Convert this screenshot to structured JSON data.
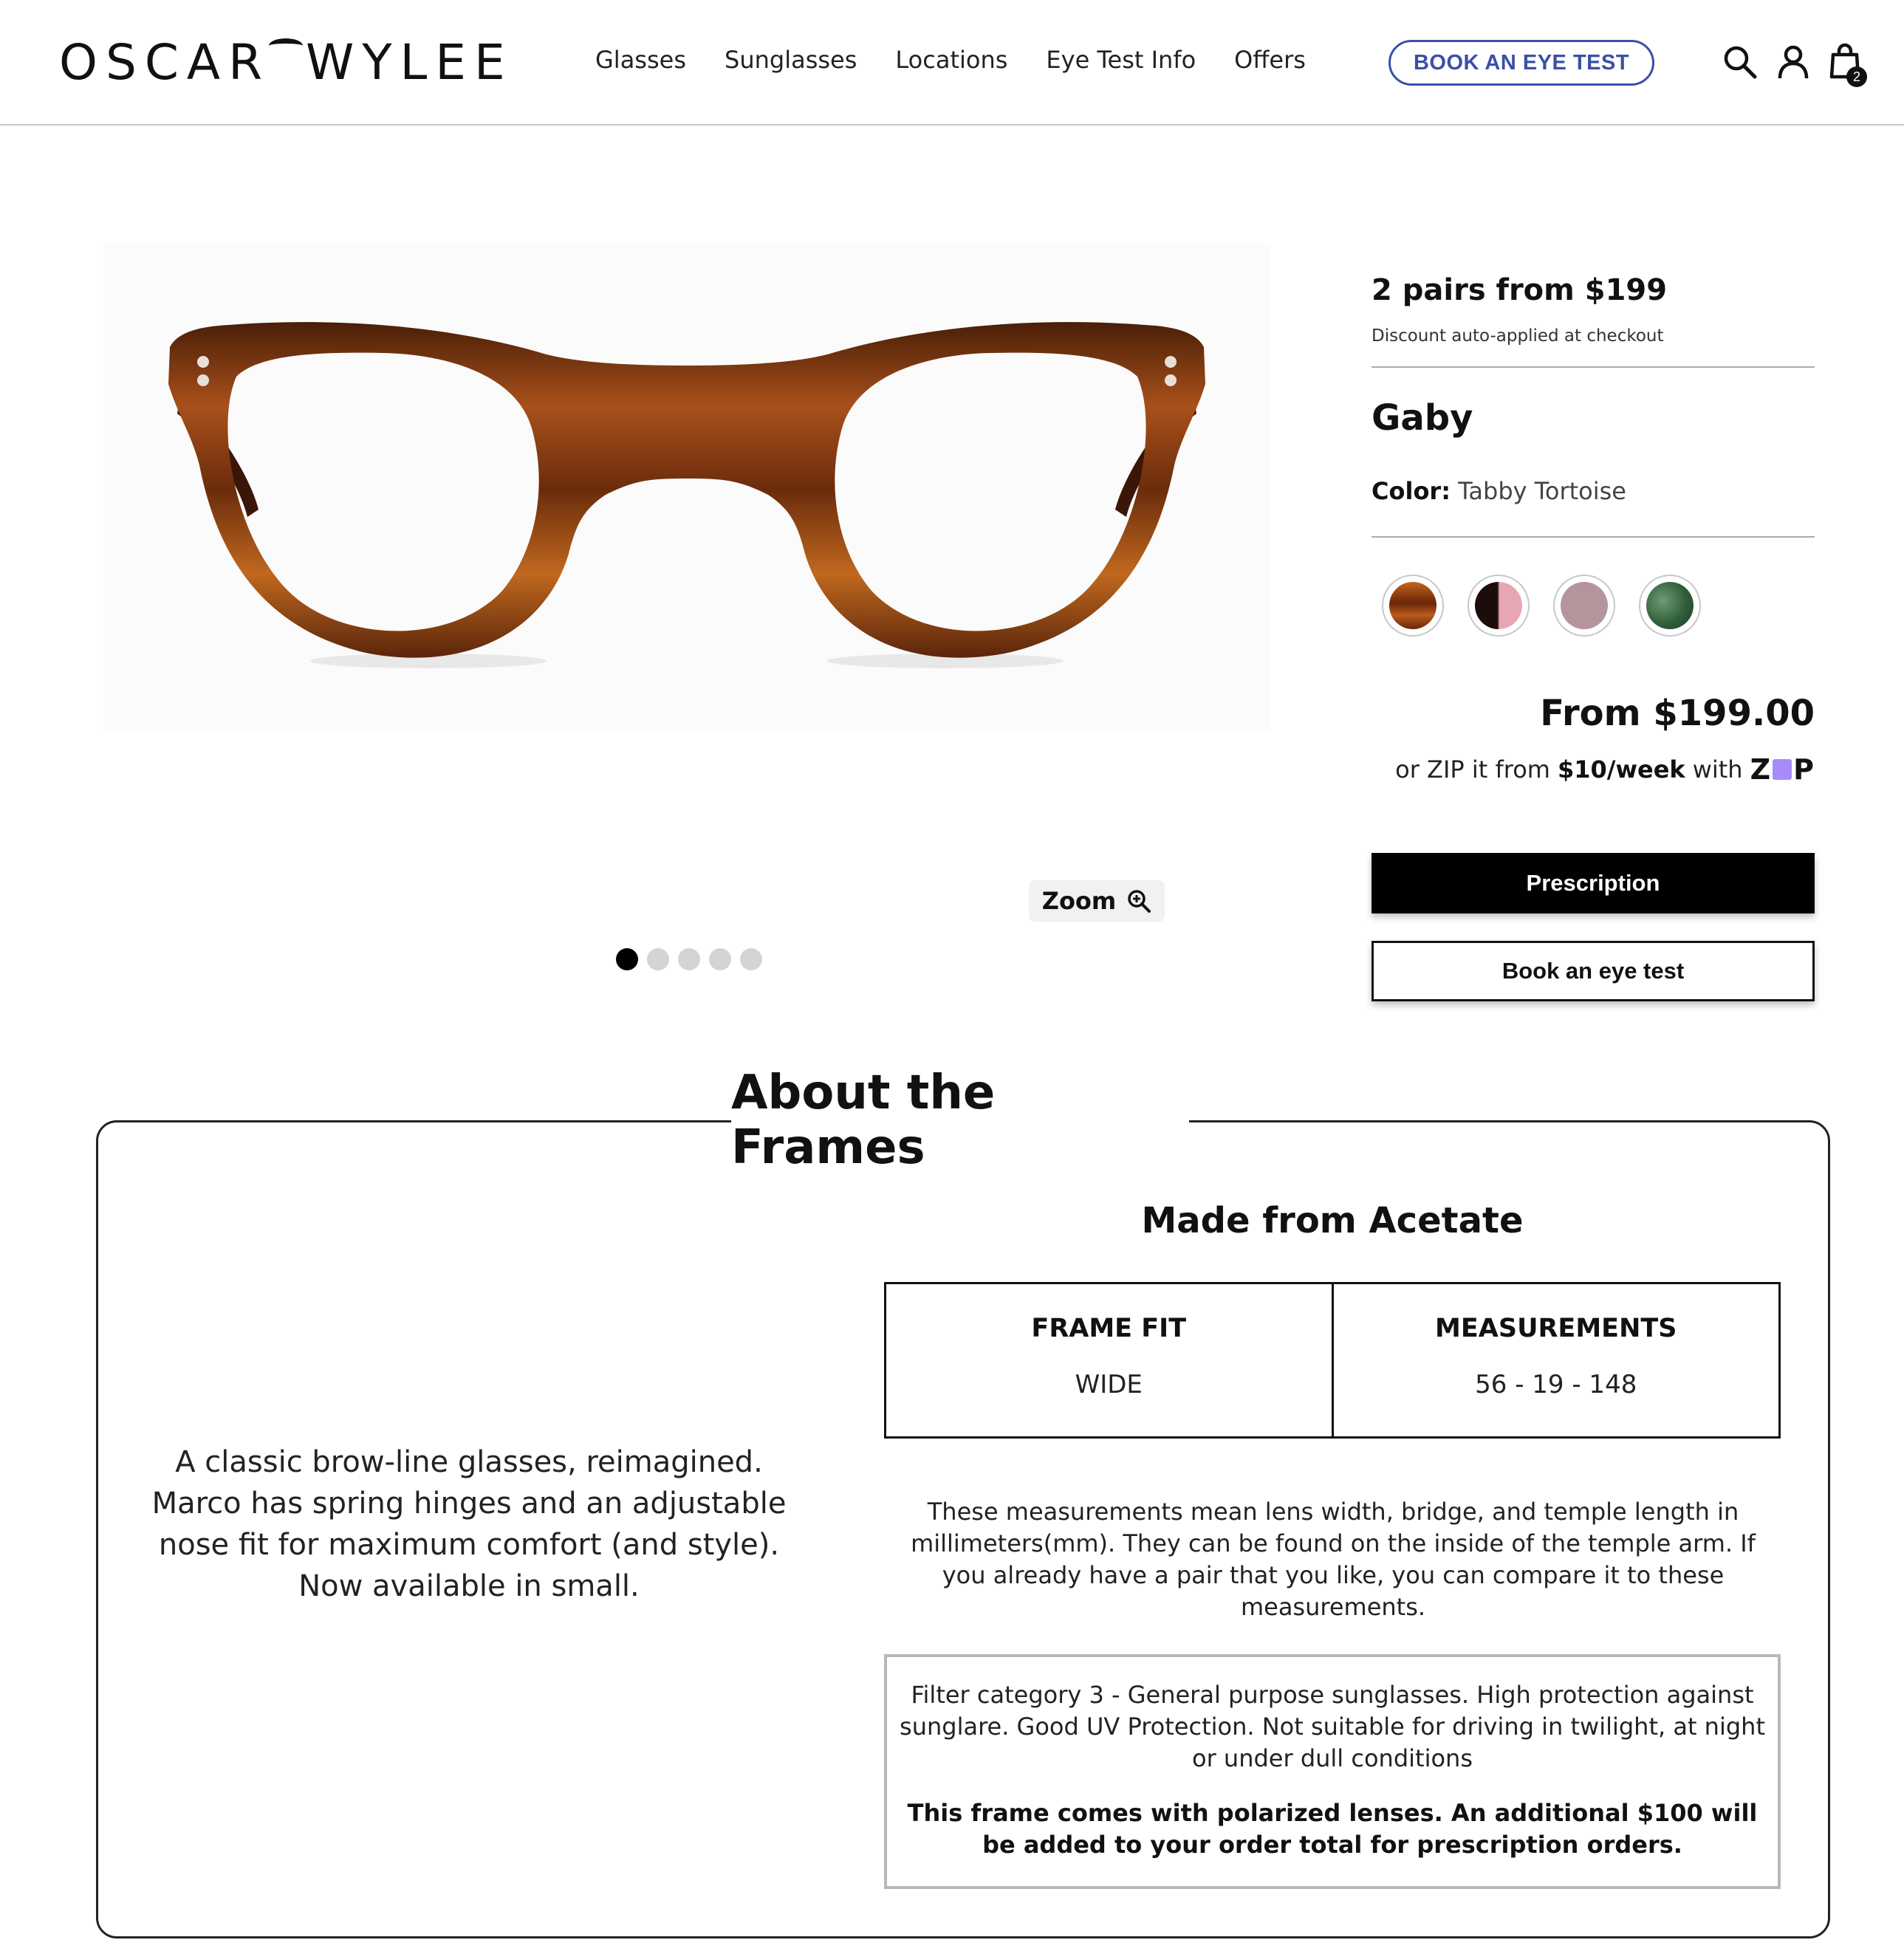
{
  "header": {
    "logo_left": "OSCAR",
    "logo_right": "WYLEE",
    "nav": [
      "Glasses",
      "Sunglasses",
      "Locations",
      "Eye Test Info",
      "Offers"
    ],
    "book_button": "BOOK AN EYE TEST",
    "cart_count": "2",
    "accent_color": "#3a4fa8"
  },
  "gallery": {
    "zoom_label": "Zoom",
    "total_images": 5,
    "active_index": 0
  },
  "product": {
    "promo_title": "2 pairs from $199",
    "promo_sub": "Discount auto-applied at checkout",
    "name": "Gaby",
    "color_label": "Color:",
    "color_value": "Tabby Tortoise",
    "swatches": [
      {
        "name": "tabby-tortoise",
        "colors": [
          "#8a3a10",
          "#c4641c"
        ]
      },
      {
        "name": "black-pink",
        "colors": [
          "#2a1212",
          "#e7a7b2"
        ]
      },
      {
        "name": "mauve",
        "colors": [
          "#b5959c",
          "#b5959c"
        ]
      },
      {
        "name": "green",
        "colors": [
          "#2f5e3a",
          "#5d8f66"
        ]
      }
    ],
    "price": "From $199.00",
    "zip_prefix": "or ZIP it from",
    "zip_amount": "$10/week",
    "zip_with": "with",
    "zip_logo": "zip",
    "prescription_button": "Prescription",
    "book_eye_test_button": "Book an eye test"
  },
  "about": {
    "title": "About the Frames",
    "description": "A classic brow-line glasses, reimagined. Marco has spring hinges and an adjustable nose fit for maximum comfort (and style). Now available in small.",
    "material": "Made from Acetate",
    "frame_fit_label": "FRAME FIT",
    "frame_fit_value": "WIDE",
    "measurements_label": "MEASUREMENTS",
    "measurements_value": "56 - 19 - 148",
    "measurements_note": "These measurements mean lens width, bridge, and temple length in millimeters(mm). They can be found on the inside of the temple arm. If you already have a pair that you like, you can compare it to these measurements.",
    "filter_note": "Filter category 3 - General purpose sunglasses. High protection against sunglare. Good UV Protection. Not suitable for driving in twilight, at night or under dull conditions",
    "polarized_note": "This frame comes with polarized lenses. An additional $100 will be added to your order total for prescription orders."
  }
}
